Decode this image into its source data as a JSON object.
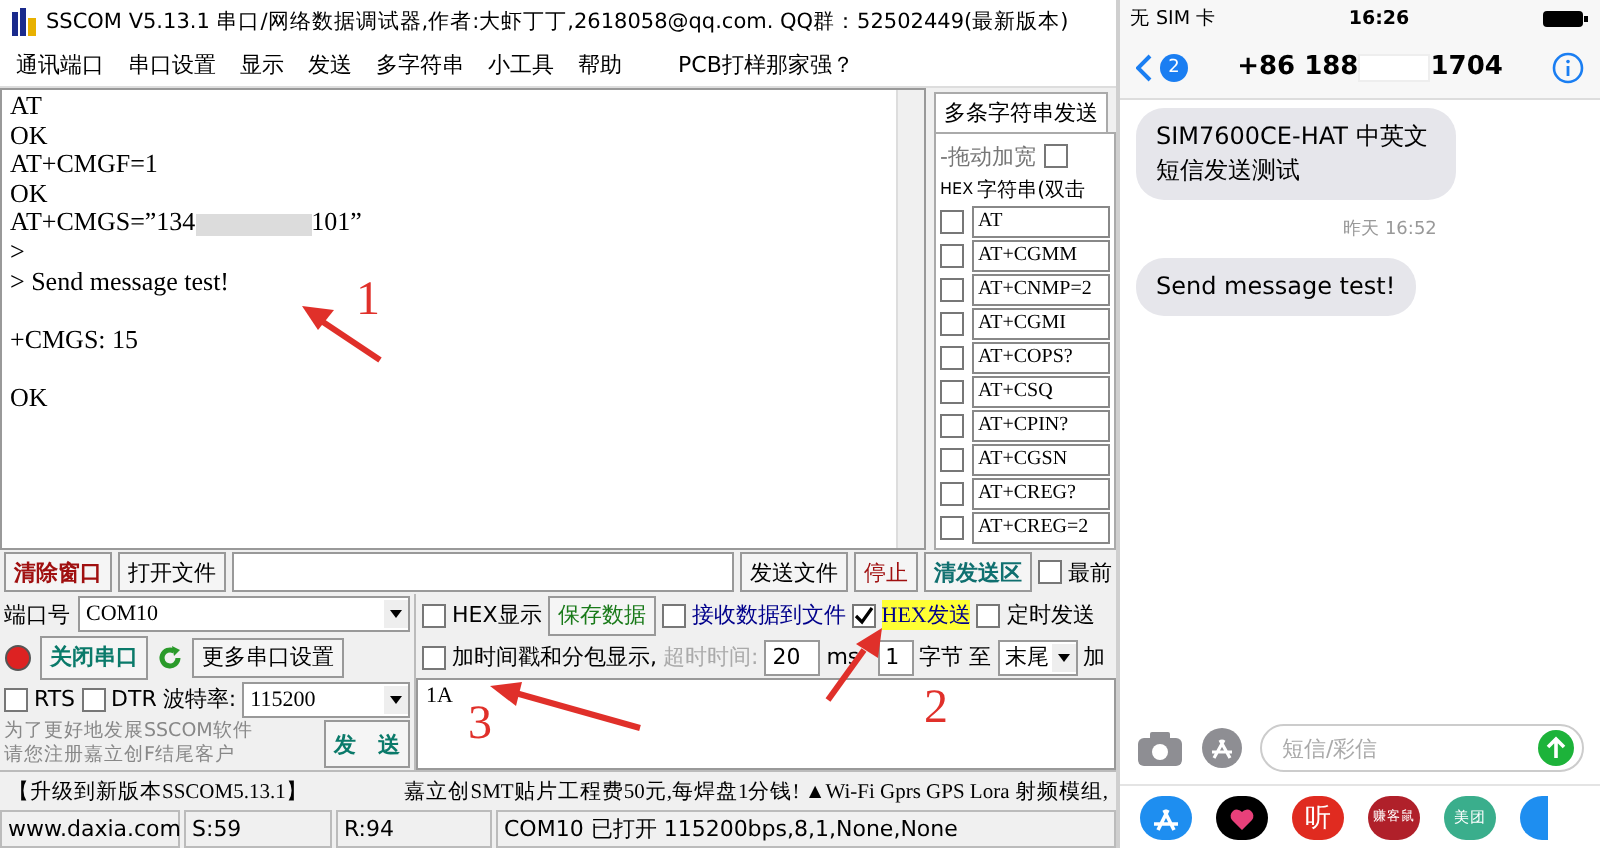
{
  "window": {
    "title": "SSCOM V5.13.1 串口/网络数据调试器,作者:大虾丁丁,2618058@qq.com. QQ群：52502449(最新版本)"
  },
  "menu": [
    "通讯端口",
    "串口设置",
    "显示",
    "发送",
    "多字符串",
    "小工具",
    "帮助",
    "PCB打样那家强？"
  ],
  "terminal": {
    "lines": [
      {
        "kind": "text",
        "text": "AT"
      },
      {
        "kind": "text",
        "text": "OK"
      },
      {
        "kind": "text",
        "text": "AT+CMGF=1"
      },
      {
        "kind": "text",
        "text": "OK"
      },
      {
        "kind": "redacted",
        "before": "AT+CMGS=”134",
        "after": "101”"
      },
      {
        "kind": "text",
        "text": ">"
      },
      {
        "kind": "text",
        "text": "> Send message test!"
      },
      {
        "kind": "blank"
      },
      {
        "kind": "text",
        "text": "+CMGS: 15"
      },
      {
        "kind": "blank"
      },
      {
        "kind": "text",
        "text": "OK"
      }
    ]
  },
  "multi_panel": {
    "tab": "多条字符串发送",
    "drag_label": "-拖动加宽",
    "drag_checked": false,
    "hex_header": "HEX",
    "string_header": "字符串(双击",
    "rows": [
      {
        "text": "AT",
        "hex": false
      },
      {
        "text": "AT+CGMM",
        "hex": false
      },
      {
        "text": "AT+CNMP=2",
        "hex": false
      },
      {
        "text": "AT+CGMI",
        "hex": false
      },
      {
        "text": "AT+COPS?",
        "hex": false
      },
      {
        "text": "AT+CSQ",
        "hex": false
      },
      {
        "text": "AT+CPIN?",
        "hex": false
      },
      {
        "text": "AT+CGSN",
        "hex": false
      },
      {
        "text": "AT+CREG?",
        "hex": false
      },
      {
        "text": "AT+CREG=2",
        "hex": false
      }
    ]
  },
  "file_row": {
    "clear": "清除窗口",
    "open_file": "打开文件",
    "send_file": "发送文件",
    "stop": "停止",
    "clear_send": "清发送区",
    "topmost": {
      "label": "最前",
      "checked": false
    }
  },
  "port": {
    "label": "端口号",
    "value": "COM10",
    "close_button": "关闭串口",
    "more": "更多串口设置",
    "rts": {
      "label": "RTS",
      "checked": false
    },
    "dtr": {
      "label": "DTR",
      "checked": false
    },
    "baud_label": "波特率:",
    "baud": "115200",
    "promo": [
      "为了更好地发展SSCOM软件",
      "请您注册嘉立创F结尾客户"
    ],
    "send": "发　送"
  },
  "options": {
    "hex_display": {
      "label": "HEX显示",
      "checked": false
    },
    "save": "保存数据",
    "recv_to_file": {
      "label": "接收数据到文件",
      "checked": false
    },
    "hex_send": {
      "label": "HEX发送",
      "checked": true
    },
    "timed_send": {
      "label": "定时发送",
      "checked": false
    },
    "timestamp": {
      "label": "加时间戳和分包显示,",
      "checked": false
    },
    "timeout_label": "超时时间:",
    "timeout": "20",
    "timeout_disabled": true,
    "ms": "ms",
    "byte_from": "1",
    "bytes": "字节",
    "to": "至",
    "end": "末尾",
    "add": "加"
  },
  "send_text": "1A",
  "marquee": [
    "【升级到新版本SSCOM5.13.1】",
    "嘉立创SMT贴片工程费50元,每焊盘1分钱! ▲Wi-Fi Gprs GPS Lora 射频模组,"
  ],
  "status_bar": [
    "www.daxia.com",
    "S:59",
    "R:94",
    "COM10 已打开  115200bps,8,1,None,None"
  ],
  "annotations": [
    "1",
    "2",
    "3"
  ],
  "phone": {
    "carrier": "无 SIM 卡",
    "time": "16:26",
    "badge": "2",
    "number_start": "+86 188",
    "number_end": "1704",
    "messages": [
      {
        "kind": "bubble",
        "text": "SIM7600CE-HAT 中英文短信发送测试"
      },
      {
        "kind": "time",
        "text": "昨天 16:52"
      },
      {
        "kind": "bubble",
        "text": "Send message test!"
      }
    ],
    "placeholder": "短信/彩信",
    "apps": [
      {
        "kind": "store"
      },
      {
        "kind": "heart"
      },
      {
        "kind": "label",
        "label": "听",
        "color": "#e02b20"
      },
      {
        "kind": "label",
        "label": "赚客鼠",
        "color": "#b0202a"
      },
      {
        "kind": "label",
        "label": "美团",
        "color": "#3aae8c"
      },
      {
        "kind": "edge"
      }
    ]
  }
}
